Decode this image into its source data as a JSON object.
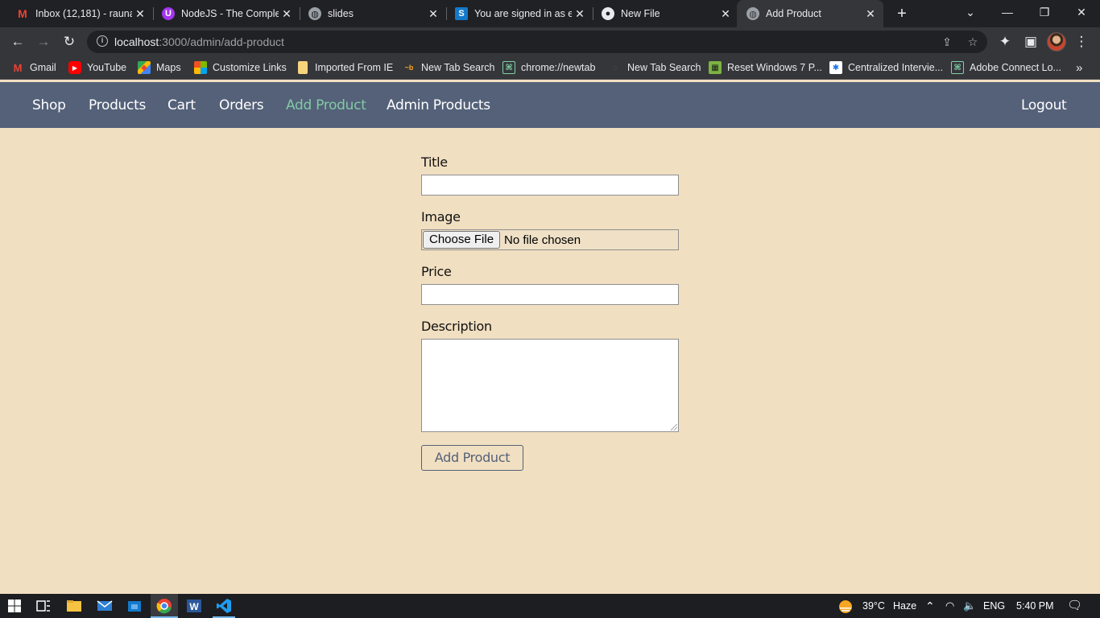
{
  "browser": {
    "tabs": [
      {
        "title": "Inbox (12,181) - rauna",
        "icon": "gmail-icon",
        "active": false
      },
      {
        "title": "NodeJS - The Complet",
        "icon": "udemy-icon",
        "active": false
      },
      {
        "title": "slides",
        "icon": "globe-icon",
        "active": false
      },
      {
        "title": "You are signed in as e",
        "icon": "s-logo-icon",
        "active": false
      },
      {
        "title": "New File",
        "icon": "github-icon",
        "active": false
      },
      {
        "title": "Add Product",
        "icon": "globe-icon",
        "active": true
      }
    ],
    "url_host": "localhost",
    "url_path": ":3000/admin/add-product",
    "bookmarks": [
      {
        "label": "Gmail",
        "icon": "gmail-icon"
      },
      {
        "label": "YouTube",
        "icon": "youtube-icon"
      },
      {
        "label": "Maps",
        "icon": "maps-icon"
      },
      {
        "label": "Customize Links",
        "icon": "windows-logo-icon"
      },
      {
        "label": "Imported From IE",
        "icon": "folder-icon"
      },
      {
        "label": "New Tab Search",
        "icon": "search-engine-icon"
      },
      {
        "label": "chrome://newtab",
        "icon": "page-icon"
      },
      {
        "label": "New Tab Search",
        "icon": "search-engine-icon"
      },
      {
        "label": "Reset Windows 7 P...",
        "icon": "page-icon"
      },
      {
        "label": "Centralized Intervie...",
        "icon": "page-icon"
      },
      {
        "label": "Adobe Connect Lo...",
        "icon": "page-icon"
      }
    ]
  },
  "nav": {
    "links": [
      "Shop",
      "Products",
      "Cart",
      "Orders",
      "Add Product",
      "Admin Products"
    ],
    "active_link": "Add Product",
    "logout": "Logout"
  },
  "form": {
    "title_label": "Title",
    "title_value": "",
    "image_label": "Image",
    "file_button": "Choose File",
    "file_status": "No file chosen",
    "price_label": "Price",
    "price_value": "",
    "description_label": "Description",
    "description_value": "",
    "submit_label": "Add Product"
  },
  "taskbar": {
    "weather_temp": "39°C",
    "weather_desc": "Haze",
    "language": "ENG",
    "time": "5:40 PM"
  },
  "colors": {
    "page_bg": "#f1dfc1",
    "nav_bg": "#546179",
    "nav_active": "#82c9a4"
  }
}
